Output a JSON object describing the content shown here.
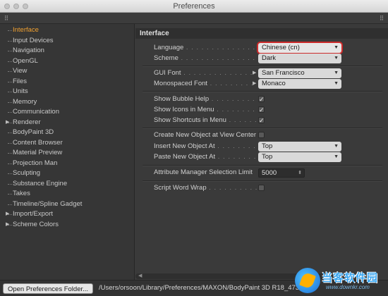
{
  "window": {
    "title": "Preferences"
  },
  "sidebar": {
    "items": [
      {
        "label": "Interface",
        "active": true,
        "expandable": false
      },
      {
        "label": "Input Devices",
        "active": false,
        "expandable": false
      },
      {
        "label": "Navigation",
        "active": false,
        "expandable": false
      },
      {
        "label": "OpenGL",
        "active": false,
        "expandable": false
      },
      {
        "label": "View",
        "active": false,
        "expandable": false
      },
      {
        "label": "Files",
        "active": false,
        "expandable": false
      },
      {
        "label": "Units",
        "active": false,
        "expandable": false
      },
      {
        "label": "Memory",
        "active": false,
        "expandable": false
      },
      {
        "label": "Communication",
        "active": false,
        "expandable": false
      },
      {
        "label": "Renderer",
        "active": false,
        "expandable": true
      },
      {
        "label": "BodyPaint 3D",
        "active": false,
        "expandable": false
      },
      {
        "label": "Content Browser",
        "active": false,
        "expandable": false
      },
      {
        "label": "Material Preview",
        "active": false,
        "expandable": false
      },
      {
        "label": "Projection Man",
        "active": false,
        "expandable": false
      },
      {
        "label": "Sculpting",
        "active": false,
        "expandable": false
      },
      {
        "label": "Substance Engine",
        "active": false,
        "expandable": false
      },
      {
        "label": "Takes",
        "active": false,
        "expandable": false
      },
      {
        "label": "Timeline/Spline Gadget",
        "active": false,
        "expandable": false
      },
      {
        "label": "Import/Export",
        "active": false,
        "expandable": true
      },
      {
        "label": "Scheme Colors",
        "active": false,
        "expandable": true
      }
    ]
  },
  "content": {
    "section_title": "Interface",
    "language": {
      "label": "Language",
      "value": "Chinese (cn)"
    },
    "scheme": {
      "label": "Scheme",
      "value": "Dark"
    },
    "gui_font": {
      "label": "GUI Font",
      "value": "San Francisco"
    },
    "mono_font": {
      "label": "Monospaced Font",
      "value": "Monaco"
    },
    "bubble_help": {
      "label": "Show Bubble Help",
      "checked": true
    },
    "icons_in_menu": {
      "label": "Show Icons in Menu",
      "checked": true
    },
    "shortcuts_in_menu": {
      "label": "Show Shortcuts in Menu",
      "checked": true
    },
    "create_at_center": {
      "label": "Create New Object at View Center",
      "checked": false
    },
    "insert_at": {
      "label": "Insert New Object At",
      "value": "Top"
    },
    "paste_at": {
      "label": "Paste New Object At",
      "value": "Top"
    },
    "attr_limit": {
      "label": "Attribute Manager Selection Limit",
      "value": "5000"
    },
    "word_wrap": {
      "label": "Script Word Wrap",
      "checked": false
    }
  },
  "statusbar": {
    "open_button": "Open Preferences Folder...",
    "path": "/Users/orsoon/Library/Preferences/MAXON/BodyPaint 3D R18_47313..."
  },
  "watermark": {
    "text": "当客软件园",
    "sub": "www.downkr.com"
  },
  "icons": {
    "check": "checkmark-icon",
    "dropdown": "dropdown-caret-icon",
    "expand": "expand-triangle-icon"
  }
}
